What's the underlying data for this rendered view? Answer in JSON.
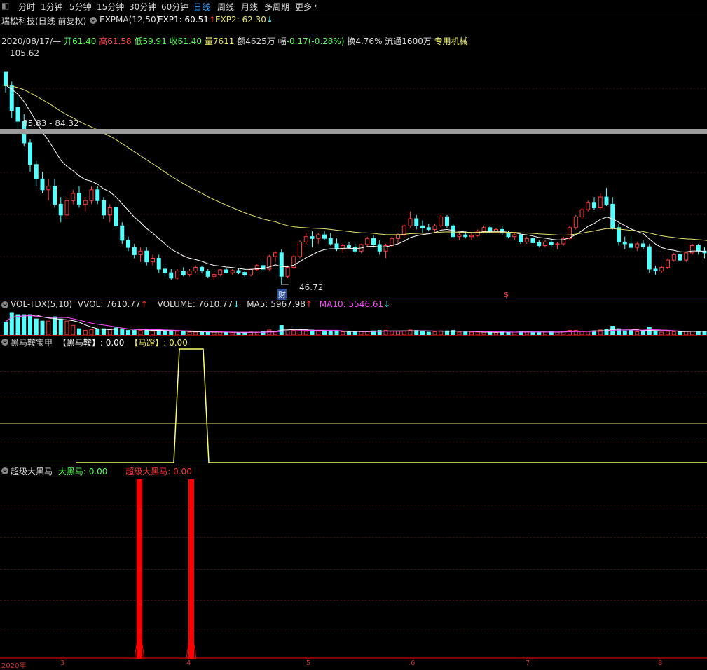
{
  "toolbar": {
    "items": [
      "分时",
      "1分钟",
      "5分钟",
      "15分钟",
      "30分钟",
      "60分钟",
      "日线",
      "周线",
      "月线",
      "多周期",
      "更多"
    ],
    "active": "日线"
  },
  "main_header": {
    "title": "瑞松科技(日线 前复权)",
    "indicator": "EXPMA(12,50)",
    "exp1": "EXP1: 60.51",
    "exp2": "EXP2: 62.30"
  },
  "quote": {
    "date": "2020/08/17/—",
    "open_label": "开",
    "open": "61.40",
    "high_label": "高",
    "high": "61.58",
    "low_label": "低",
    "low": "59.91",
    "close_label": "收",
    "close": "61.40",
    "vol_label": "量",
    "vol": "7611",
    "amt": "额4625万",
    "chg_label": "幅",
    "chg": "-0.17(-0.28%)",
    "turnover": "换4.76%",
    "float": "流通1600万",
    "industry": "专用机械"
  },
  "annotations": {
    "high_price": "105.62",
    "band": "85.83 - 84.32",
    "low_price": "46.72",
    "event_marker": "财",
    "dollar_marker": "$"
  },
  "vol_header": {
    "name": "VOL-TDX(5,10)",
    "vvol": "VVOL: 7610.77",
    "volume": "VOLUME: 7610.77",
    "ma5": "MA5: 5967.98",
    "ma10": "MA10: 5546.61"
  },
  "hm_header": {
    "name": "黑马鞍宝甲",
    "l1": "【黑马鞍】: 0.00",
    "l2": "【马蹬】: 0.00"
  },
  "sh_header": {
    "name": "超级大黑马",
    "l1": "大黑马: 0.00",
    "l2": "超级大黑马: 0.00"
  },
  "x_axis": {
    "labels": [
      "2020年",
      "3",
      "4",
      "5",
      "6",
      "7",
      "8"
    ]
  },
  "colors": {
    "up": "#ff3b3b",
    "down": "#54ffff",
    "exp1": "#ffffff",
    "exp2": "#e6e66a",
    "signal": "#ffff66",
    "bar": "#ff0000",
    "ma10": "#ff44ff"
  },
  "chart_data": {
    "type": "candlestick",
    "candles": [
      [
        105.6,
        105.6,
        100,
        102
      ],
      [
        102,
        103,
        93,
        95
      ],
      [
        96,
        99,
        90,
        92
      ],
      [
        92,
        94,
        85,
        86
      ],
      [
        86,
        87,
        78,
        80
      ],
      [
        80,
        81,
        74,
        76
      ],
      [
        76,
        78,
        72,
        73
      ],
      [
        73,
        76,
        70,
        74
      ],
      [
        74,
        76,
        68,
        69
      ],
      [
        69,
        71,
        64,
        66
      ],
      [
        66,
        71,
        65,
        70
      ],
      [
        70,
        73,
        69,
        72
      ],
      [
        72,
        74,
        68,
        69
      ],
      [
        69,
        71,
        67,
        70
      ],
      [
        70,
        74,
        69,
        73
      ],
      [
        73,
        74,
        69,
        70
      ],
      [
        70,
        71,
        65,
        66
      ],
      [
        66,
        69,
        64,
        68
      ],
      [
        68,
        69,
        62,
        63
      ],
      [
        63,
        64,
        58,
        59
      ],
      [
        59,
        60,
        56,
        57
      ],
      [
        57,
        58,
        54,
        55
      ],
      [
        55,
        57,
        53,
        56
      ],
      [
        56,
        57,
        52,
        53
      ],
      [
        53,
        55,
        52,
        54
      ],
      [
        54,
        55,
        50,
        51
      ],
      [
        51,
        52,
        49,
        50
      ],
      [
        50,
        51,
        48,
        48.5
      ],
      [
        48.5,
        51,
        48,
        50.5
      ],
      [
        50.5,
        51.5,
        49,
        49.5
      ],
      [
        49.5,
        51,
        49,
        50.5
      ],
      [
        50.5,
        52,
        50,
        51.5
      ],
      [
        51.5,
        52,
        50,
        50.5
      ],
      [
        50.5,
        51,
        48.5,
        49
      ],
      [
        49,
        50,
        48,
        49.5
      ],
      [
        49.5,
        51,
        49,
        50.8
      ],
      [
        50.8,
        51.2,
        49.8,
        50
      ],
      [
        50,
        51,
        49.5,
        50.6
      ],
      [
        50.6,
        51.2,
        49.6,
        50.1
      ],
      [
        50.1,
        50.6,
        48.8,
        49.4
      ],
      [
        49.4,
        51.2,
        49,
        50.9
      ],
      [
        50.9,
        52.5,
        50.5,
        52
      ],
      [
        52,
        53,
        50.5,
        51
      ],
      [
        51,
        55,
        50.5,
        54.5
      ],
      [
        54.5,
        56,
        53,
        55.5
      ],
      [
        55.5,
        56.5,
        46.72,
        49
      ],
      [
        49,
        52,
        48.5,
        51.5
      ],
      [
        51.5,
        55,
        51,
        54.5
      ],
      [
        54.5,
        59,
        54,
        58.5
      ],
      [
        58.5,
        61,
        58,
        60
      ],
      [
        60,
        61.5,
        57,
        59.5
      ],
      [
        59.5,
        61,
        58,
        60.5
      ],
      [
        60.5,
        61.5,
        59,
        59.5
      ],
      [
        59.5,
        61,
        57.5,
        58
      ],
      [
        58,
        59.5,
        56,
        56.5
      ],
      [
        56.5,
        58,
        55.5,
        57.5
      ],
      [
        57.5,
        58.5,
        56.5,
        57
      ],
      [
        57,
        58,
        55.5,
        56
      ],
      [
        56,
        58,
        55.5,
        57.8
      ],
      [
        57.8,
        60,
        57,
        59.5
      ],
      [
        59.5,
        60.5,
        57,
        57.8
      ],
      [
        57.8,
        59,
        55,
        56
      ],
      [
        56,
        58,
        54,
        57.5
      ],
      [
        57.5,
        60,
        57,
        59.5
      ],
      [
        59.5,
        61,
        58,
        60.5
      ],
      [
        60.5,
        63.5,
        60,
        63
      ],
      [
        63,
        67,
        62.5,
        65
      ],
      [
        65,
        66,
        62,
        63
      ],
      [
        63,
        64.5,
        61,
        62.5
      ],
      [
        62.5,
        63.5,
        61.5,
        62
      ],
      [
        62,
        63.5,
        61,
        63
      ],
      [
        63,
        66,
        62.5,
        65.5
      ],
      [
        65.5,
        66,
        62.5,
        63
      ],
      [
        63,
        63.5,
        59.5,
        60
      ],
      [
        60,
        61,
        59,
        60.5
      ],
      [
        60.5,
        61.5,
        59.5,
        60
      ],
      [
        60,
        61,
        59,
        60.3
      ],
      [
        60.3,
        62,
        60,
        61.5
      ],
      [
        61.5,
        63,
        61,
        62.5
      ],
      [
        62.5,
        63,
        61,
        61.5
      ],
      [
        61.5,
        62.5,
        61,
        62
      ],
      [
        62,
        63,
        60.5,
        61
      ],
      [
        61,
        61.5,
        59.5,
        60
      ],
      [
        60,
        61,
        59,
        60.5
      ],
      [
        60.5,
        61,
        58,
        58.5
      ],
      [
        58.5,
        60,
        58,
        59.5
      ],
      [
        59.5,
        60,
        58,
        58.3
      ],
      [
        58.3,
        59,
        57,
        57.5
      ],
      [
        57.5,
        59,
        57,
        58.5
      ],
      [
        58.5,
        59.5,
        57,
        57.8
      ],
      [
        57.8,
        58.5,
        56.5,
        58
      ],
      [
        58,
        60,
        57.5,
        59.5
      ],
      [
        59.5,
        63,
        59,
        62.5
      ],
      [
        62.5,
        66,
        62,
        65.5
      ],
      [
        65.5,
        68,
        65,
        67.5
      ],
      [
        67.5,
        70,
        67,
        69.5
      ],
      [
        69.5,
        71,
        67.5,
        68
      ],
      [
        68,
        72,
        67.5,
        71
      ],
      [
        71,
        73.5,
        68.5,
        69
      ],
      [
        69,
        71,
        62,
        62.5
      ],
      [
        62.5,
        63.5,
        57.5,
        58.5
      ],
      [
        58.5,
        60,
        56.5,
        58
      ],
      [
        58,
        60,
        56,
        57
      ],
      [
        57,
        58.5,
        56,
        58
      ],
      [
        58,
        59,
        56.5,
        57.2
      ],
      [
        57.2,
        58,
        50,
        51
      ],
      [
        51,
        52,
        49.5,
        50.5
      ],
      [
        50.5,
        52,
        50,
        51.5
      ],
      [
        51.5,
        54,
        51,
        53.5
      ],
      [
        53.5,
        55.5,
        53,
        55
      ],
      [
        55,
        56,
        53,
        53.5
      ],
      [
        53.5,
        56,
        53,
        55.5
      ],
      [
        55.5,
        58,
        55,
        57.5
      ],
      [
        57.5,
        58,
        55,
        56
      ],
      [
        56,
        57,
        54,
        55.5
      ],
      [
        55.5,
        56,
        52.5,
        53
      ],
      [
        53,
        54.5,
        52.5,
        54
      ],
      [
        54,
        55,
        51.5,
        52
      ],
      [
        52,
        54,
        51.5,
        53.5
      ]
    ],
    "price_range": [
      46.72,
      105.62
    ]
  }
}
